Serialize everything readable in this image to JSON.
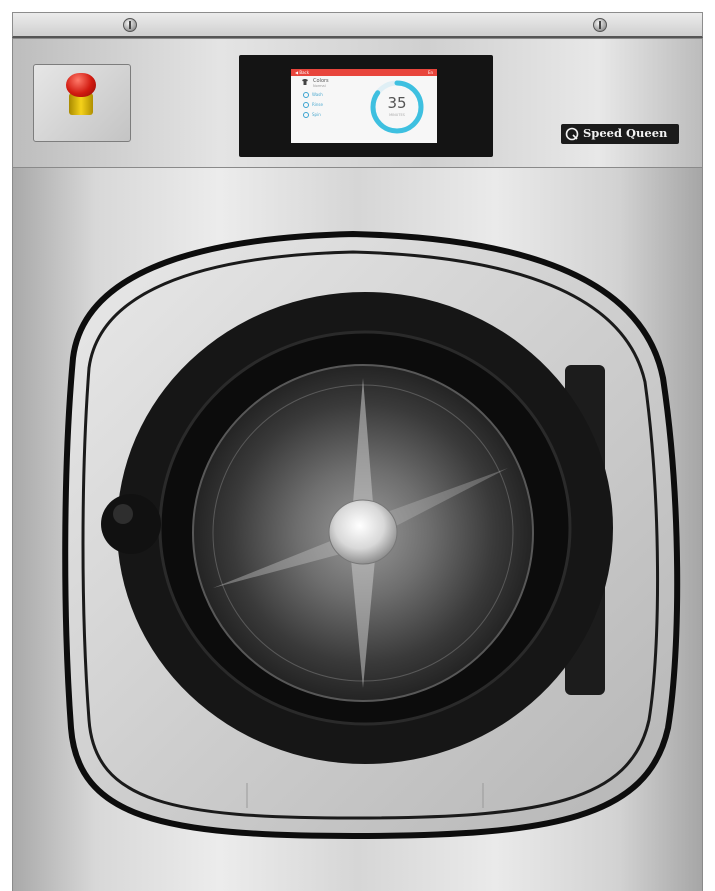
{
  "machine": {
    "brand": "Speed Queen",
    "colors": {
      "accent_red": "#e8453c",
      "ring_blue": "#3ec0e0",
      "step_blue": "#4aa8cf"
    }
  },
  "display": {
    "header_left": "◀ Back",
    "header_right": "En",
    "cycle_name": "Colors",
    "cycle_sub": "Normal",
    "steps": [
      {
        "label": "Wash",
        "icon": "wash-icon"
      },
      {
        "label": "Rinse",
        "icon": "rinse-icon"
      },
      {
        "label": "Spin",
        "icon": "spin-icon"
      }
    ],
    "timer": {
      "value": "35",
      "unit": "MINUTES",
      "progress": 0.85
    }
  },
  "icons": {
    "emergency_stop": "emergency-stop-icon",
    "brand_logo": "speed-queen-logo-icon"
  }
}
